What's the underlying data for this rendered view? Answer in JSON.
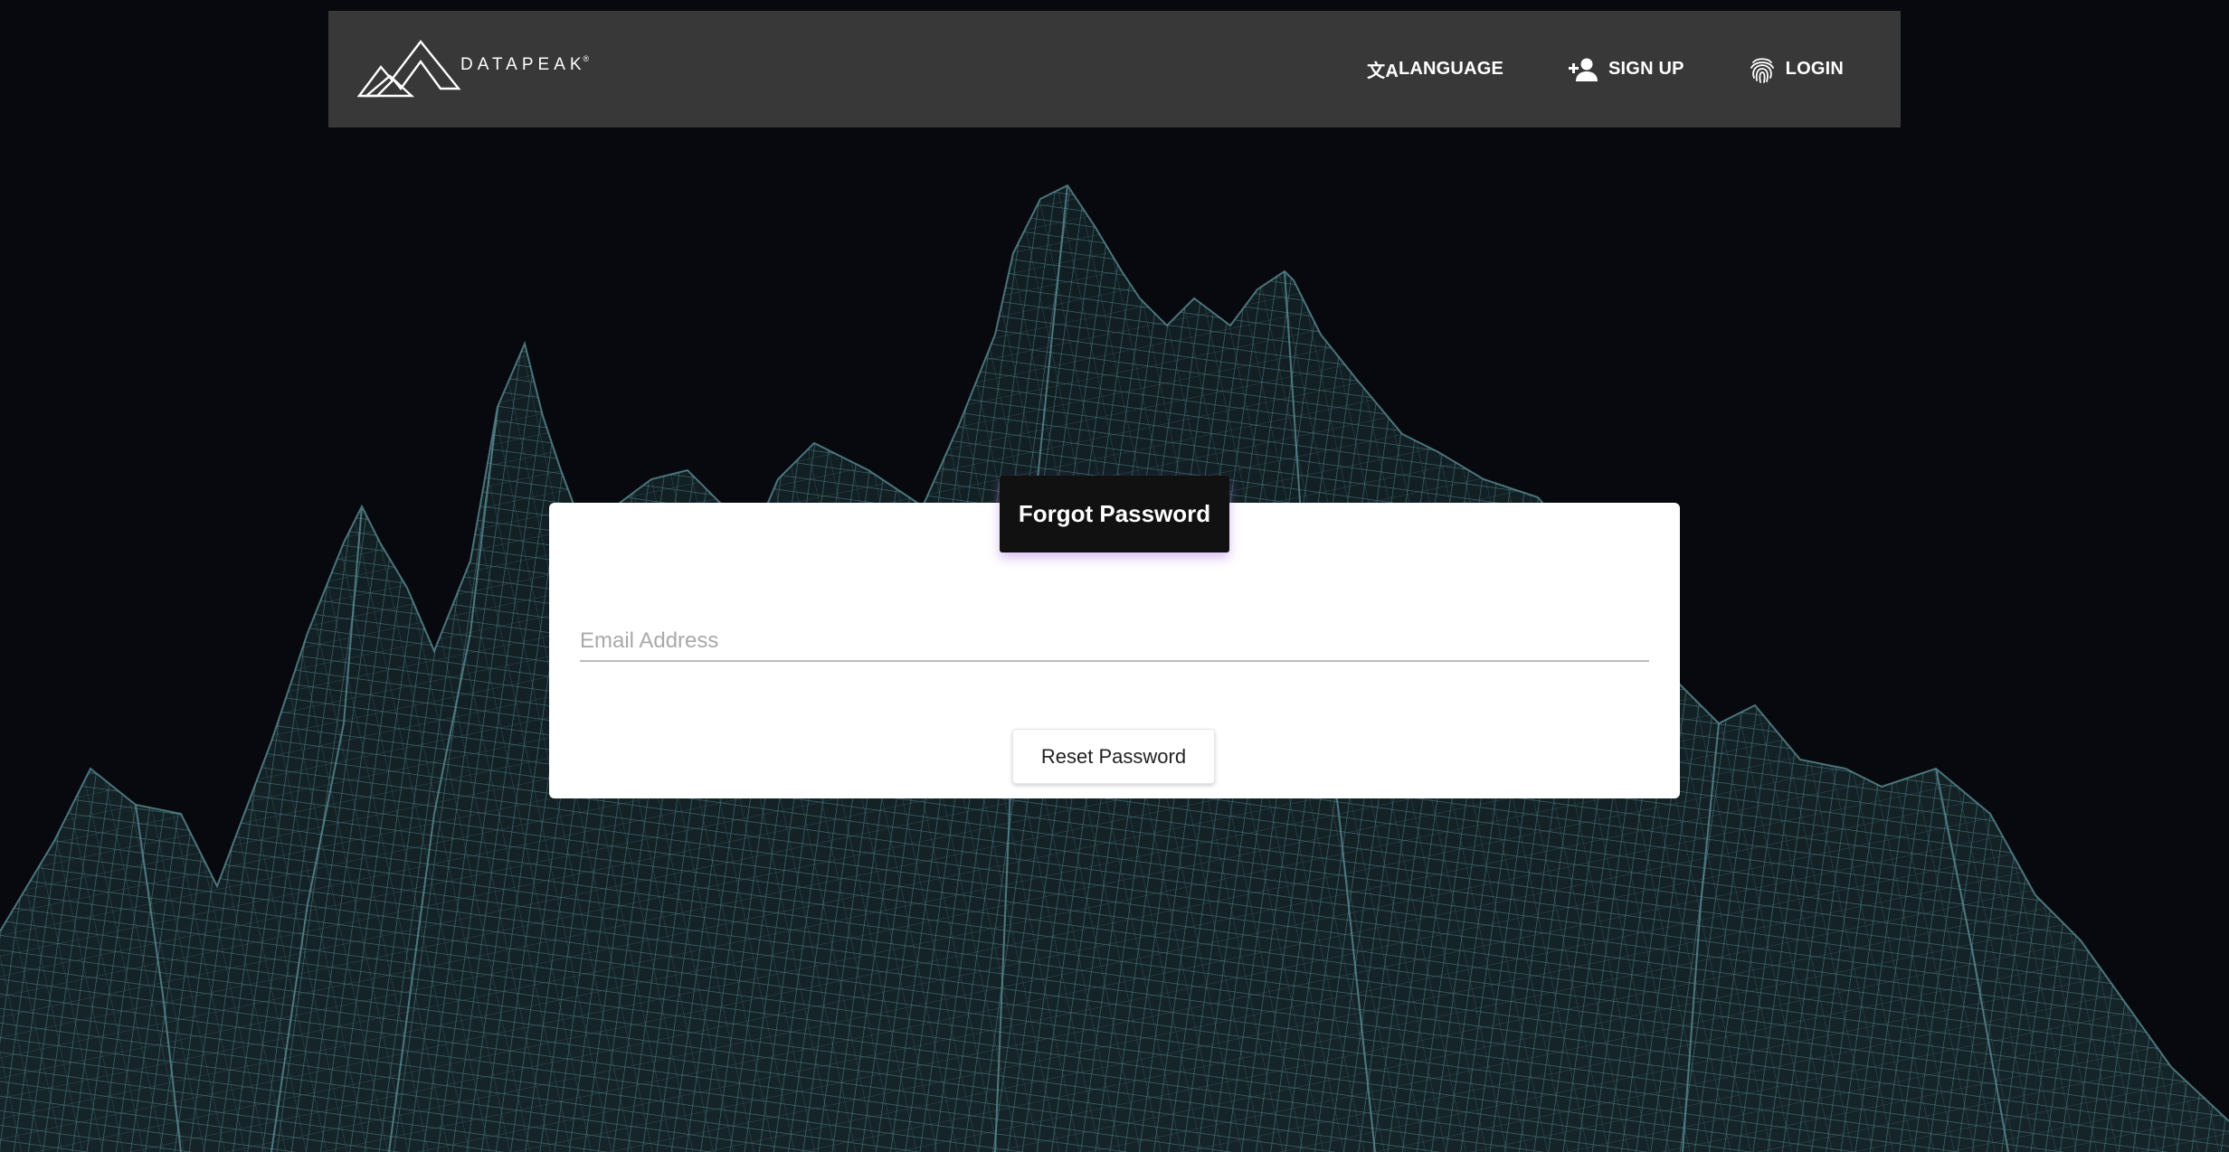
{
  "brand": {
    "name": "DATAPEAK",
    "trademark": "®"
  },
  "nav": {
    "language_label": "LANGUAGE",
    "language_glyph": "文A",
    "signup_label": "SIGN UP",
    "login_label": "LOGIN"
  },
  "form": {
    "title": "Forgot Password",
    "email_placeholder": "Email Address",
    "email_value": "",
    "submit_label": "Reset Password"
  },
  "colors": {
    "background": "#08090f",
    "navbar": "#383838",
    "mesh": "#4f7f86",
    "title_glow": "#aa6edc"
  },
  "icons": {
    "language": "translate-icon",
    "signup": "person-add-icon",
    "login": "fingerprint-icon"
  }
}
